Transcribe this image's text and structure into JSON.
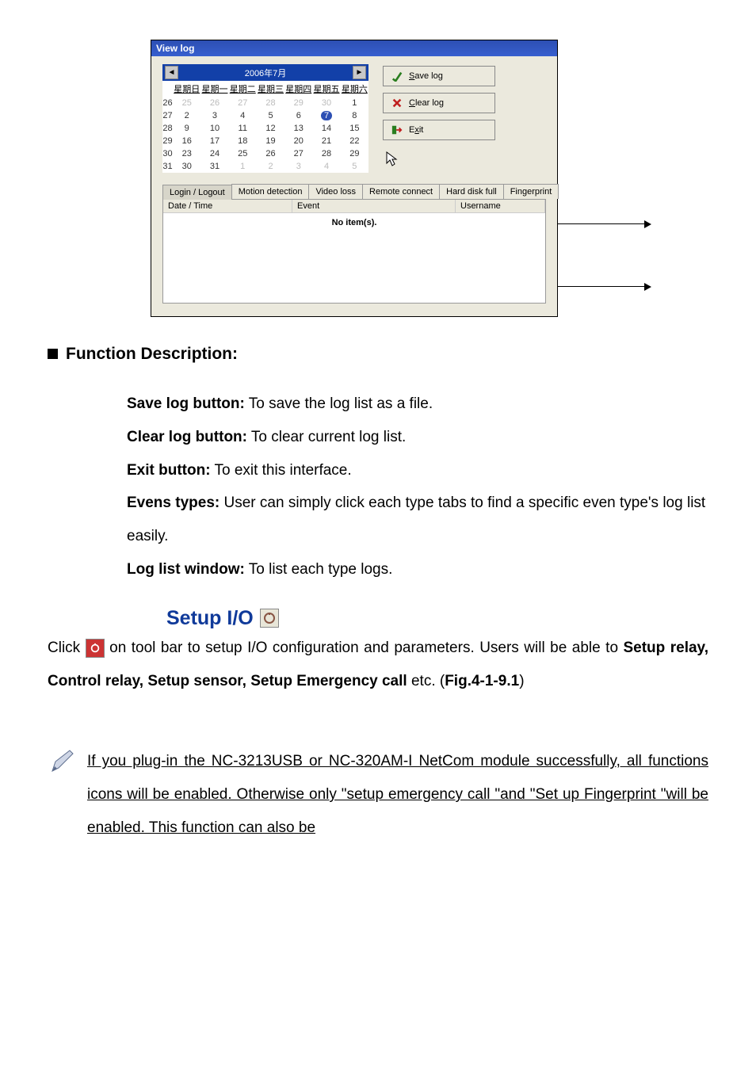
{
  "viewlog": {
    "title": "View log",
    "month_label": "2006年7月",
    "weekdays": [
      "星期日",
      "星期一",
      "星期二",
      "星期三",
      "星期四",
      "星期五",
      "星期六"
    ],
    "week_numbers": [
      "26",
      "27",
      "28",
      "29",
      "30",
      "31"
    ],
    "grid": [
      [
        "25",
        "26",
        "27",
        "28",
        "29",
        "30",
        "1"
      ],
      [
        "2",
        "3",
        "4",
        "5",
        "6",
        "7",
        "8"
      ],
      [
        "9",
        "10",
        "11",
        "12",
        "13",
        "14",
        "15"
      ],
      [
        "16",
        "17",
        "18",
        "19",
        "20",
        "21",
        "22"
      ],
      [
        "23",
        "24",
        "25",
        "26",
        "27",
        "28",
        "29"
      ],
      [
        "30",
        "31",
        "1",
        "2",
        "3",
        "4",
        "5"
      ]
    ],
    "today_cell": "7",
    "dim_rows": [
      0,
      5
    ],
    "buttons": {
      "save": "Save log",
      "clear": "Clear log",
      "exit": "Exit"
    },
    "tabs": [
      "Login / Logout",
      "Motion detection",
      "Video loss",
      "Remote connect",
      "Hard disk full",
      "Fingerprint"
    ],
    "active_tab_index": 0,
    "columns": {
      "datetime": "Date / Time",
      "event": "Event",
      "username": "Username"
    },
    "no_items": "No item(s)."
  },
  "fd_heading": "Function Description:",
  "defs": {
    "save_b": "Save log button:",
    "save_t": " To save the log list as a file.",
    "clear_b": "Clear log button:",
    "clear_t": " To clear current log list.",
    "exit_b": "Exit button:",
    "exit_t": " To exit this interface.",
    "evens_b": "Evens types:",
    "evens_t": " User can simply click each type tabs to find a specific even type's log list easily.",
    "log_b": "Log list window:",
    "log_t": " To list each type logs."
  },
  "setup_io": {
    "title": "Setup I/O",
    "para_pre": "Click ",
    "para_mid": " on tool bar to setup I/O configuration and parameters. Users will be able to ",
    "para_bold": "Setup relay, Control relay, Setup sensor, Setup Emergency call",
    "para_post1": " etc. (",
    "para_fig": "Fig.4-1-9.1",
    "para_post2": ")"
  },
  "note": "If you plug-in the NC-3213USB or NC-320AM-I NetCom module successfully, all functions icons will be enabled.  Otherwise only \"setup emergency call \"and \"Set up Fingerprint \"will be enabled.  This function can also be"
}
